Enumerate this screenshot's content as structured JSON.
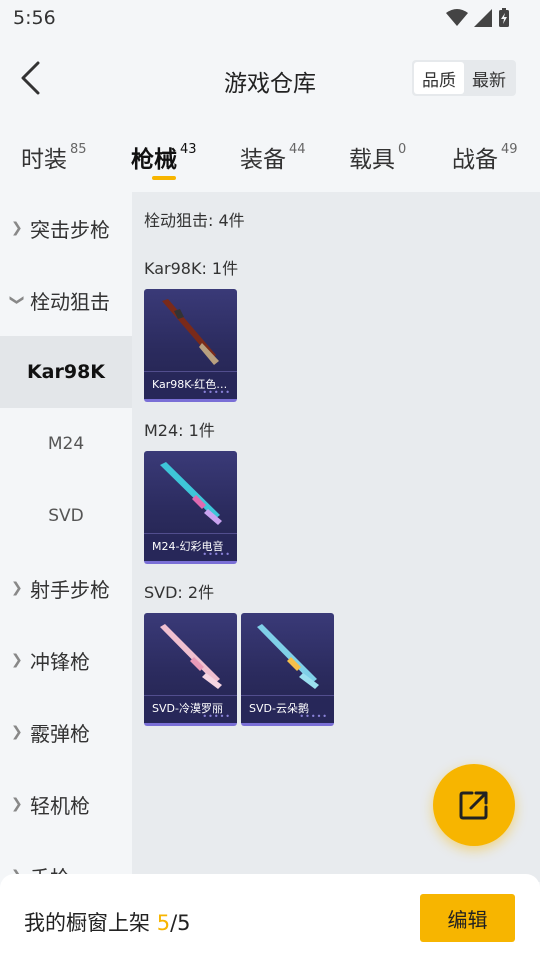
{
  "status_bar": {
    "time": "5:56"
  },
  "header": {
    "title": "游戏仓库",
    "sort_options": [
      "品质",
      "最新"
    ]
  },
  "tabs": [
    {
      "label": "时装",
      "count": "85"
    },
    {
      "label": "枪械",
      "count": "43"
    },
    {
      "label": "装备",
      "count": "44"
    },
    {
      "label": "载具",
      "count": "0"
    },
    {
      "label": "战备",
      "count": "49"
    }
  ],
  "sidebar": {
    "items": [
      {
        "label": "突击步枪"
      },
      {
        "label": "栓动狙击"
      },
      {
        "label": "Kar98K"
      },
      {
        "label": "M24"
      },
      {
        "label": "SVD"
      },
      {
        "label": "射手步枪"
      },
      {
        "label": "冲锋枪"
      },
      {
        "label": "霰弹枪"
      },
      {
        "label": "轻机枪"
      },
      {
        "label": "手枪"
      }
    ]
  },
  "content": {
    "summary": "栓动狙击: 4件",
    "groups": [
      {
        "title": "Kar98K: 1件",
        "cards": [
          {
            "caption": "Kar98K-红色…"
          }
        ]
      },
      {
        "title": "M24: 1件",
        "cards": [
          {
            "caption": "M24-幻彩电音"
          }
        ]
      },
      {
        "title": "SVD: 2件",
        "cards": [
          {
            "caption": "SVD-冷漠罗丽"
          },
          {
            "caption": "SVD-云朵鹅"
          }
        ]
      }
    ]
  },
  "bottom_bar": {
    "label": "我的橱窗上架 ",
    "current": "5",
    "separator": "/",
    "total": "5",
    "edit_label": "编辑"
  },
  "colors": {
    "accent": "#f7b500",
    "card_bg": "#2b2b5e",
    "card_border": "#7a6fd6"
  }
}
